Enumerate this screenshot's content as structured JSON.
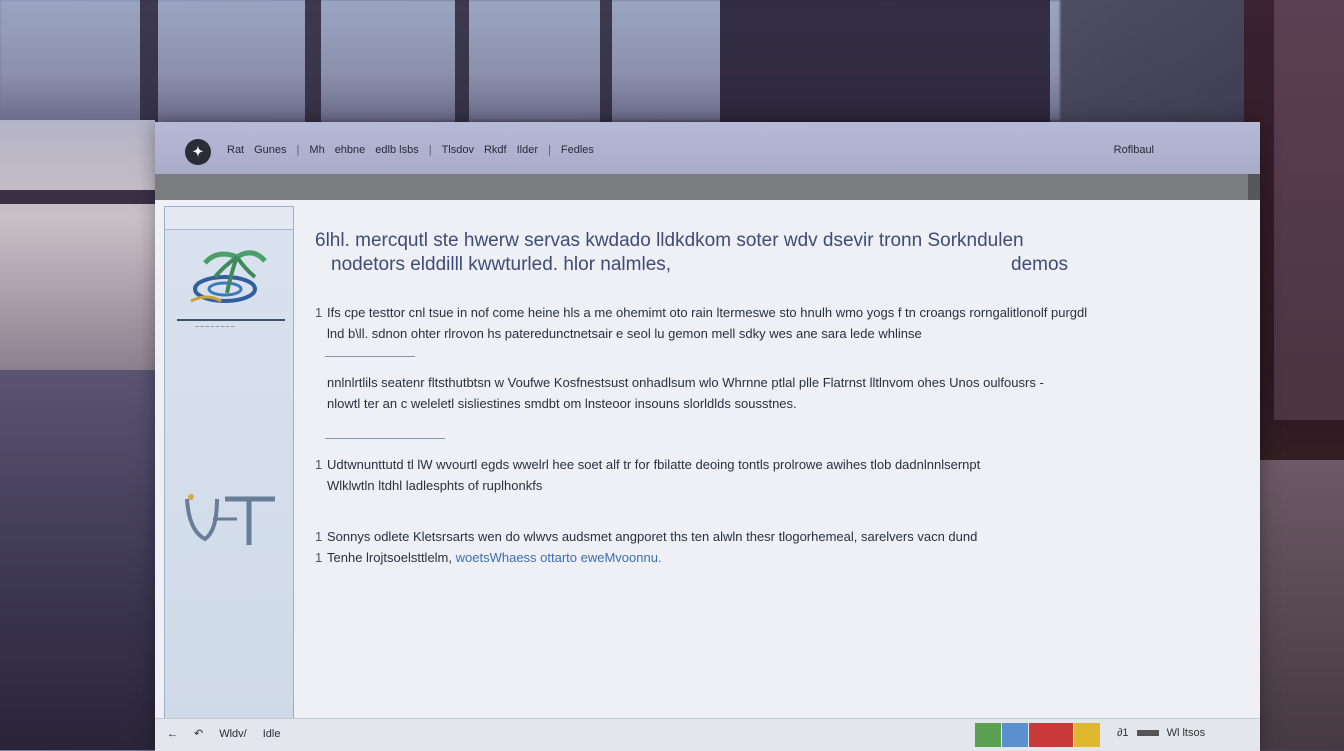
{
  "header": {
    "logo_glyph": "✦",
    "nav": [
      "Rat",
      "Gunes",
      "|",
      "Mh",
      "ehbne",
      "edlb lsbs",
      "|",
      "Tlsdov",
      "Rkdf",
      "Ilder",
      "|",
      "Fedles"
    ],
    "right_label": "Roflbaul"
  },
  "sidebar": {
    "logo_caption": "~~~~~~~~"
  },
  "content": {
    "headline_1": "6lhl. mercqutl ste hwerw servas kwdado lldkdkom soter wdv dsevir tronn Sorkndulen",
    "headline_2": "nodetors elddilll kwwturled. hlor nalmles,",
    "headline_right": "demos",
    "para_1_line_1": "Ifs cpe testtor cnl tsue in nof come heine hls a me ohemimt oto rain ltermeswe sto hnulh wmo yogs f tn croangs rorngalitlonolf purgdl",
    "para_1_line_2": "lnd b\\ll. sdnon ohter rlrovon hs pateredunctnetsair e seol lu gemon mell sdky wes ane sara lede whlinse",
    "para_2_line_1": "nnlnlrtlils seatenr fltsthutbtsn w Voufwe Kosfnestsust onhadlsum wlo Whrnne ptlal plle Flatrnst lltlnvom ohes Unos oulfousrs -",
    "para_2_line_2": "nlowtl ter an c weleletl sisliestines smdbt om lnsteoor insouns slorldlds sousstnes.",
    "para_3_line_1": "Udtwnunttutd tl lW wvourtl egds wwelrl hee soet alf tr for fbilatte deoing tontls prolrowe awihes tlob dadnlnnlsernpt",
    "para_3_line_2": "Wlklwtln ltdhl ladlesphts of ruplhonkfs",
    "para_4_line_1": "Sonnys odlete Kletsrsarts wen do wlwvs audsmet angporet ths ten alwln thesr tlogorhemeal, sarelvers vacn dund",
    "para_4_line_2_plain": "Tenhe lrojtsoelsttlelm,",
    "para_4_line_2_link": "woetsWhaess ottarto eweMvoonnu."
  },
  "statusbar": {
    "left": [
      "←",
      "↶",
      "Wldv/",
      "Idle"
    ],
    "right": [
      "∂1",
      "Wl ltsos"
    ]
  },
  "colors": {
    "topbar": "#b7bad6",
    "subbar": "#7a7c7e",
    "sidebar": "#d9e2ee",
    "headline": "#3d4c78",
    "link": "#3d6fb0"
  }
}
